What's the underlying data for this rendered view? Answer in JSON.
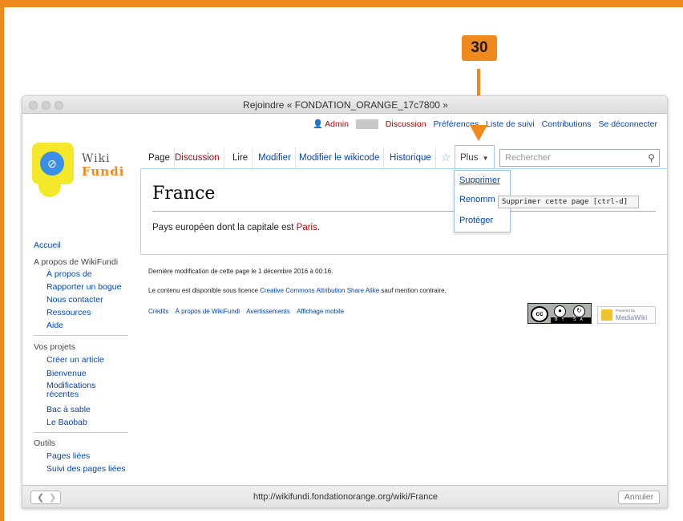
{
  "annotation": {
    "step_number": "30",
    "accent_color": "#f08a1c"
  },
  "window": {
    "title": "Rejoindre « FONDATION_ORANGE_17c7800 »",
    "status_url": "http://wikifundi.fondationorange.org/wiki/France",
    "cancel_label": "Annuler",
    "back_icon": "chevron-left",
    "forward_icon": "chevron-right"
  },
  "userbar": {
    "admin": "Admin",
    "discussion": "Discussion",
    "preferences": "Préférences",
    "watchlist": "Liste de suivi",
    "contributions": "Contributions",
    "logout": "Se déconnecter"
  },
  "logo": {
    "line1": "Wiki",
    "line2": "Fundi"
  },
  "tabs": {
    "page": "Page",
    "discussion": "Discussion",
    "read": "Lire",
    "edit": "Modifier",
    "edit_source": "Modifier le wikicode",
    "history": "Historique",
    "more": "Plus"
  },
  "search": {
    "placeholder": "Rechercher"
  },
  "more_menu": {
    "items": [
      "Supprimer",
      "Renomm",
      "Protéger"
    ]
  },
  "tooltip": "Supprimer cette page [ctrl-d]",
  "article": {
    "title": "France",
    "body_prefix": "Pays européen dont la capitale est ",
    "body_link": "Paris",
    "body_suffix": "."
  },
  "sidebar": {
    "home": "Accueil",
    "section1_title": "A propos de WikiFundi",
    "section1_items": [
      "À propos de",
      "Rapporter un bogue",
      "Nous contacter",
      "Ressources",
      "Aide"
    ],
    "section2_title": "Vos projets",
    "section2_items": [
      "Créer un article",
      "Bienvenue",
      "Modifications",
      "récentes",
      "Bac à sable",
      "Le Baobab"
    ],
    "section3_title": "Outils",
    "section3_items": [
      "Pages liées",
      "Suivi des pages liées"
    ]
  },
  "footer": {
    "last_modified": "Dernière modification de cette page le 1 décembre 2016 à 00:16.",
    "license_prefix": "Le contenu est disponible sous licence ",
    "license_link": "Creative Commons Attribution Share Alike",
    "license_suffix": " sauf mention contraire.",
    "links": [
      "Crédits",
      "À propos de WikiFundi",
      "Avertissements",
      "Affichage mobile"
    ],
    "cc_badge": {
      "icon": "cc",
      "by": "BY",
      "sa": "SA"
    },
    "mediawiki_badge": {
      "line1": "Powered By",
      "line2": "MediaWiki"
    }
  }
}
